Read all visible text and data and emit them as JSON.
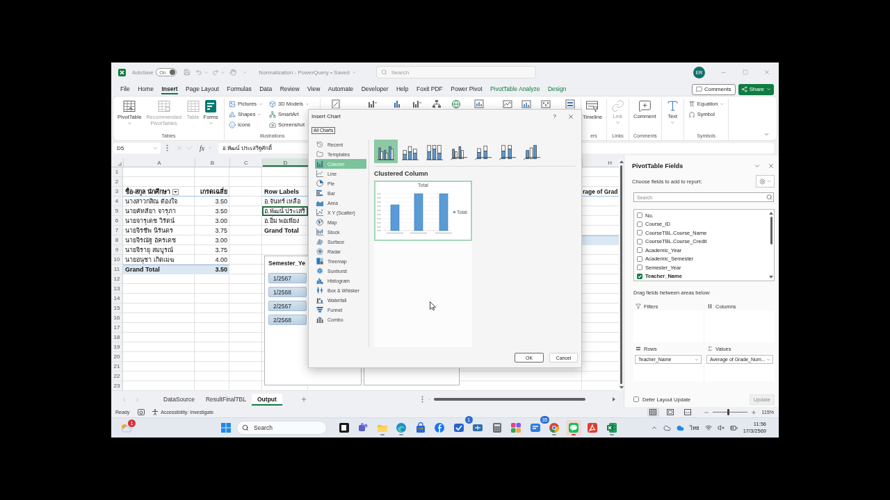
{
  "title_bar": {
    "autosave": {
      "label": "AutoSave",
      "toggle_text": "On",
      "on": true
    },
    "document": {
      "title": "Normalization - PowerQuery • Saved",
      "menu": true
    },
    "search": {
      "placeholder": "Search"
    },
    "account": {
      "initials": "ER"
    }
  },
  "ribbon_tabs": [
    {
      "label": "File",
      "selected": false,
      "contextual": false
    },
    {
      "label": "Home",
      "selected": false,
      "contextual": false
    },
    {
      "label": "Insert",
      "selected": true,
      "contextual": false
    },
    {
      "label": "Page Layout",
      "selected": false,
      "contextual": false
    },
    {
      "label": "Formulas",
      "selected": false,
      "contextual": false
    },
    {
      "label": "Data",
      "selected": false,
      "contextual": false
    },
    {
      "label": "Review",
      "selected": false,
      "contextual": false
    },
    {
      "label": "View",
      "selected": false,
      "contextual": false
    },
    {
      "label": "Automate",
      "selected": false,
      "contextual": false
    },
    {
      "label": "Developer",
      "selected": false,
      "contextual": false
    },
    {
      "label": "Help",
      "selected": false,
      "contextual": false
    },
    {
      "label": "Foxit PDF",
      "selected": false,
      "contextual": false
    },
    {
      "label": "Power Pivot",
      "selected": false,
      "contextual": false
    },
    {
      "label": "PivotTable Analyze",
      "selected": false,
      "contextual": true
    },
    {
      "label": "Design",
      "selected": false,
      "contextual": true
    }
  ],
  "header_actions": [
    {
      "kind": "comments",
      "label": "Comments"
    },
    {
      "kind": "share",
      "label": "Share"
    }
  ],
  "ribbon_groups": [
    {
      "label": "Tables",
      "commands": [
        {
          "kind": "pivot-table",
          "label": "PivotTable",
          "menu": true,
          "disabled": false
        },
        {
          "kind": "recommended-pivot",
          "label": "Recommended PivotTables",
          "menu": false,
          "disabled": true
        },
        {
          "kind": "table",
          "label": "Table",
          "menu": false,
          "disabled": true
        },
        {
          "kind": "forms",
          "label": "Forms",
          "menu": true,
          "disabled": false
        }
      ]
    },
    {
      "label": "Illustrations",
      "stacked_commands": [
        {
          "kind": "pictures",
          "label": "Pictures",
          "menu": true,
          "disabled": false
        },
        {
          "kind": "shapes",
          "label": "Shapes",
          "menu": true,
          "disabled": false
        },
        {
          "kind": "icons",
          "label": "Icons",
          "menu": false,
          "disabled": false
        },
        {
          "kind": "models",
          "label": "3D Models",
          "menu": true,
          "disabled": false
        },
        {
          "kind": "smartart",
          "label": "SmartArt",
          "menu": false,
          "disabled": false
        },
        {
          "kind": "screenshot",
          "label": "Screenshot",
          "menu": true,
          "disabled": false
        }
      ]
    },
    {
      "label": "ers",
      "commands": [
        {
          "kind": "timeline",
          "label": "Timeline",
          "menu": false,
          "disabled": false
        }
      ]
    },
    {
      "label": "Links",
      "commands": [
        {
          "kind": "link",
          "label": "Link",
          "menu": true,
          "disabled": true
        }
      ]
    },
    {
      "label": "Comments",
      "commands": [
        {
          "kind": "comment",
          "label": "Comment",
          "menu": false,
          "disabled": false
        }
      ]
    },
    {
      "commands": [
        {
          "kind": "text",
          "label": "Text",
          "menu": true,
          "disabled": false
        }
      ]
    },
    {
      "label": "Symbols",
      "stacked_commands": [
        {
          "kind": "equation",
          "label": "Equation",
          "menu": true,
          "disabled": false
        },
        {
          "kind": "symbol",
          "label": "Symbol",
          "menu": false,
          "disabled": false
        }
      ]
    }
  ],
  "sheet": {
    "name_box": "D5",
    "function_label": "fx",
    "formula": "อ.พัฒน์ ประเสริฐศักดิ์",
    "columns": [
      {
        "label": "A",
        "selected": false
      },
      {
        "label": "B",
        "selected": false
      },
      {
        "label": "C",
        "selected": false
      },
      {
        "label": "D",
        "selected": true
      },
      {
        "label": "H",
        "selected": false
      }
    ],
    "rows": [
      {
        "number": "1"
      },
      {
        "number": "2"
      },
      {
        "number": "3",
        "a": {
          "text": "ชื่อ-สกุล นักศึกษา",
          "kind": "header",
          "selected": false,
          "filter_button": true
        },
        "b": {
          "text": "เกรดเฉลี่ย",
          "kind": "header",
          "selected": false
        },
        "d": {
          "text": "Row Labels",
          "kind": "header",
          "selected": false
        },
        "h": {
          "text": "rage of Grad",
          "kind": "header",
          "selected": false
        }
      },
      {
        "number": "4",
        "a": {
          "text": "นางสาวกสิณ ต้องใจ",
          "kind": "data",
          "selected": false
        },
        "b": {
          "text": "3.50",
          "kind": "data",
          "selected": false
        },
        "d": {
          "text": "อ.จันทร์ เหลือ",
          "kind": "data",
          "selected": false
        }
      },
      {
        "number": "5",
        "a": {
          "text": "นายคัทลียา จารุภา",
          "kind": "data",
          "selected": false
        },
        "b": {
          "text": "3.50",
          "kind": "data",
          "selected": false
        },
        "d": {
          "text": "อ.พัฒน์ ประเสริ",
          "kind": "data",
          "selected": true
        }
      },
      {
        "number": "6",
        "a": {
          "text": "นายจารุเดช วิรัตน์",
          "kind": "data",
          "selected": false
        },
        "b": {
          "text": "3.00",
          "kind": "data",
          "selected": false
        },
        "d": {
          "text": "อ.อิ่ม พอเพียง",
          "kind": "data",
          "selected": false
        }
      },
      {
        "number": "7",
        "a": {
          "text": "นายจิรชีพ นิรันดร",
          "kind": "data",
          "selected": false
        },
        "b": {
          "text": "3.75",
          "kind": "data",
          "selected": false
        },
        "d": {
          "text": "Grand Total",
          "kind": "summary",
          "selected": false
        }
      },
      {
        "number": "8",
        "a": {
          "text": "นายจิรณัฐ อัครเดช",
          "kind": "data",
          "selected": false
        },
        "b": {
          "text": "3.00",
          "kind": "data",
          "selected": false
        },
        "h": {
          "kind": "total",
          "selected": false
        }
      },
      {
        "number": "9",
        "a": {
          "text": "นายจิรายุ สมบูรณ์",
          "kind": "data",
          "selected": false
        },
        "b": {
          "text": "3.75",
          "kind": "data",
          "selected": false
        }
      },
      {
        "number": "10",
        "a": {
          "text": "นายอนุชา เกิดเมฆ",
          "kind": "data",
          "selected": false
        },
        "b": {
          "text": "4.00",
          "kind": "data",
          "selected": false
        }
      },
      {
        "number": "11",
        "a": {
          "text": "Grand Total",
          "kind": "total",
          "selected": false
        },
        "b": {
          "text": "3.50",
          "kind": "total",
          "selected": false
        }
      },
      {
        "number": "12"
      },
      {
        "number": "13"
      },
      {
        "number": "14"
      },
      {
        "number": "15"
      },
      {
        "number": "16"
      },
      {
        "number": "17"
      },
      {
        "number": "18"
      },
      {
        "number": "19"
      },
      {
        "number": "20"
      },
      {
        "number": "21"
      },
      {
        "number": "22"
      },
      {
        "number": "23"
      }
    ]
  },
  "slicer": {
    "title": "Semester_Ye",
    "items": [
      {
        "label": "1/2567",
        "selected": true
      },
      {
        "label": "1/2568",
        "selected": true
      },
      {
        "label": "2/2567",
        "selected": true
      },
      {
        "label": "2/2568",
        "selected": true
      }
    ]
  },
  "sheet_tabs": [
    {
      "label": "DataSource",
      "selected": false
    },
    {
      "label": "ResultFinalTBL",
      "selected": false
    },
    {
      "label": "Output",
      "selected": true
    }
  ],
  "insert_chart_dialog": {
    "title": "Insert Chart",
    "help": "?",
    "tabs": [
      {
        "label": "All Charts",
        "selected": true
      }
    ],
    "chart_types": [
      {
        "kind": "recent",
        "label": "Recent",
        "selected": false
      },
      {
        "kind": "templates",
        "label": "Templates",
        "selected": false
      },
      {
        "kind": "column",
        "label": "Column",
        "selected": true
      },
      {
        "kind": "line",
        "label": "Line",
        "selected": false
      },
      {
        "kind": "pie",
        "label": "Pie",
        "selected": false
      },
      {
        "kind": "bar",
        "label": "Bar",
        "selected": false
      },
      {
        "kind": "area",
        "label": "Area",
        "selected": false
      },
      {
        "kind": "scatter",
        "label": "X Y (Scatter)",
        "selected": false
      },
      {
        "kind": "map",
        "label": "Map",
        "selected": false
      },
      {
        "kind": "stock",
        "label": "Stock",
        "selected": false
      },
      {
        "kind": "surface",
        "label": "Surface",
        "selected": false
      },
      {
        "kind": "radar",
        "label": "Radar",
        "selected": false
      },
      {
        "kind": "treemap",
        "label": "Treemap",
        "selected": false
      },
      {
        "kind": "sunburst",
        "label": "Sunburst",
        "selected": false
      },
      {
        "kind": "histogram",
        "label": "Histogram",
        "selected": false
      },
      {
        "kind": "box-whisker",
        "label": "Box & Whisker",
        "selected": false
      },
      {
        "kind": "waterfall",
        "label": "Waterfall",
        "selected": false
      },
      {
        "kind": "funnel",
        "label": "Funnel",
        "selected": false
      },
      {
        "kind": "combo",
        "label": "Combo",
        "selected": false
      }
    ],
    "subtypes": [
      {
        "kind": "clustered",
        "selected": true
      },
      {
        "kind": "stacked",
        "selected": false
      },
      {
        "kind": "stacked-100",
        "selected": false
      },
      {
        "kind": "clustered-3d",
        "selected": false
      },
      {
        "kind": "stacked-3d",
        "selected": false
      },
      {
        "kind": "stacked-100-3d",
        "selected": false
      },
      {
        "kind": "column-3d",
        "selected": false
      }
    ],
    "subtype_title": "Clustered Column",
    "preview": {
      "title": "Total",
      "legend": "Total"
    },
    "buttons": [
      {
        "kind": "ok",
        "label": "OK"
      },
      {
        "kind": "cancel",
        "label": "Cancel"
      }
    ]
  },
  "pivot_fields": {
    "title": "PivotTable Fields",
    "instruction": "Choose fields to add to report:",
    "search": {
      "placeholder": "Search"
    },
    "fields": [
      {
        "label": "No.",
        "checked": false
      },
      {
        "label": "Course_ID",
        "checked": false
      },
      {
        "label": "CourseTBL.Course_Name",
        "checked": false
      },
      {
        "label": "CourseTBL.Course_Credit",
        "checked": false
      },
      {
        "label": "Academic_Year",
        "checked": false
      },
      {
        "label": "Academic_Semester",
        "checked": false
      },
      {
        "label": "Semester_Year",
        "checked": false
      },
      {
        "label": "Teacher_Name",
        "checked": true
      }
    ],
    "areas_hint": "Drag fields between areas below:",
    "areas": [
      {
        "kind": "filters",
        "label": "Filters"
      },
      {
        "kind": "columns",
        "label": "Columns"
      },
      {
        "kind": "rows",
        "label": "Rows",
        "fields": [
          "Teacher_Name"
        ]
      },
      {
        "kind": "values",
        "label": "Values",
        "fields": [
          "Average of Grade_Num..."
        ]
      }
    ],
    "defer": {
      "label": "Defer Layout Update",
      "checked": false
    },
    "update_button": {
      "label": "Update",
      "disabled": true
    }
  },
  "status_bar": {
    "ready": "Ready",
    "accessibility": "Accessibility: Investigate",
    "views": [
      {
        "kind": "normal",
        "selected": true
      },
      {
        "kind": "page-layout",
        "selected": false
      },
      {
        "kind": "page-break",
        "selected": false
      }
    ],
    "zoom": {
      "level": 0.45,
      "label": "115%"
    }
  },
  "taskbar": {
    "widget_badge": "1",
    "search": {
      "placeholder": "Search"
    },
    "apps": [
      {
        "kind": "terminal",
        "running": false,
        "active": false
      },
      {
        "kind": "teams",
        "running": false,
        "active": false
      },
      {
        "kind": "explorer",
        "running": true,
        "active": false
      },
      {
        "kind": "edge",
        "running": true,
        "active": false
      },
      {
        "kind": "store",
        "running": false,
        "active": false
      },
      {
        "kind": "social",
        "running": false,
        "active": false
      },
      {
        "kind": "todo",
        "running": false,
        "active": false,
        "badge": "1"
      },
      {
        "kind": "vpn",
        "running": false,
        "active": false
      },
      {
        "kind": "calculator",
        "running": false,
        "active": false
      },
      {
        "kind": "tiles",
        "running": false,
        "active": false
      },
      {
        "kind": "messenger",
        "running": false,
        "active": false,
        "badge": "35"
      },
      {
        "kind": "chrome",
        "running": true,
        "active": false
      },
      {
        "kind": "line",
        "running": true,
        "active": true
      },
      {
        "kind": "acrobat",
        "running": false,
        "active": false
      },
      {
        "kind": "excel",
        "running": true,
        "active": false
      }
    ],
    "language": "ไทย",
    "time": "11:56",
    "date": "17/3/2569"
  }
}
